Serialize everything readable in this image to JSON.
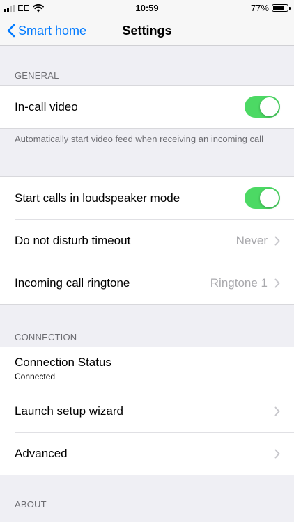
{
  "status_bar": {
    "carrier": "EE",
    "time": "10:59",
    "battery_percent": "77%",
    "battery_level": 0.77,
    "wifi_icon": "wifi-icon",
    "signal_icon": "signal-icon"
  },
  "nav": {
    "back_label": "Smart home",
    "title": "Settings"
  },
  "general": {
    "header": "GENERAL",
    "in_call_video": {
      "label": "In-call video",
      "on": true
    },
    "footnote": "Automatically start video feed when receiving an incoming call"
  },
  "calls": {
    "loudspeaker": {
      "label": "Start calls in loudspeaker mode",
      "on": true
    },
    "dnd": {
      "label": "Do not disturb timeout",
      "value": "Never"
    },
    "ringtone": {
      "label": "Incoming call ringtone",
      "value": "Ringtone 1"
    }
  },
  "connection": {
    "header": "CONNECTION",
    "status": {
      "label": "Connection Status",
      "value": "Connected"
    },
    "wizard": {
      "label": "Launch setup wizard"
    },
    "advanced": {
      "label": "Advanced"
    }
  },
  "about": {
    "header": "ABOUT"
  },
  "colors": {
    "accent": "#007aff",
    "toggle_on": "#4cd964",
    "background": "#efeff4"
  }
}
